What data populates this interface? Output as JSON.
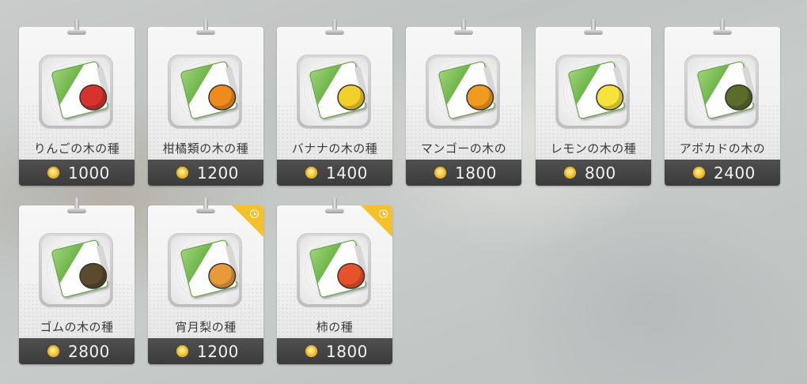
{
  "items": [
    {
      "name": "りんごの木の種",
      "price": "1000",
      "fruit_color": "#d8322e",
      "limited": false
    },
    {
      "name": "柑橘類の木の種",
      "price": "1200",
      "fruit_color": "#f08a1c",
      "limited": false
    },
    {
      "name": "バナナの木の種",
      "price": "1400",
      "fruit_color": "#f2cf2a",
      "limited": false
    },
    {
      "name": "マンゴーの木の",
      "price": "1800",
      "fruit_color": "#f09a20",
      "limited": false
    },
    {
      "name": "レモンの木の種",
      "price": "800",
      "fruit_color": "#f5e23a",
      "limited": false
    },
    {
      "name": "アボカドの木の",
      "price": "2400",
      "fruit_color": "#5a6b2a",
      "limited": false
    },
    {
      "name": "ゴムの木の種",
      "price": "2800",
      "fruit_color": "#5a4a2e",
      "limited": false
    },
    {
      "name": "宵月梨の種",
      "price": "1200",
      "fruit_color": "#e89a3a",
      "limited": true
    },
    {
      "name": "柿の種",
      "price": "1800",
      "fruit_color": "#e8522a",
      "limited": true
    }
  ],
  "icons": {
    "currency": "gold-coin-icon",
    "limited": "clock-icon"
  }
}
